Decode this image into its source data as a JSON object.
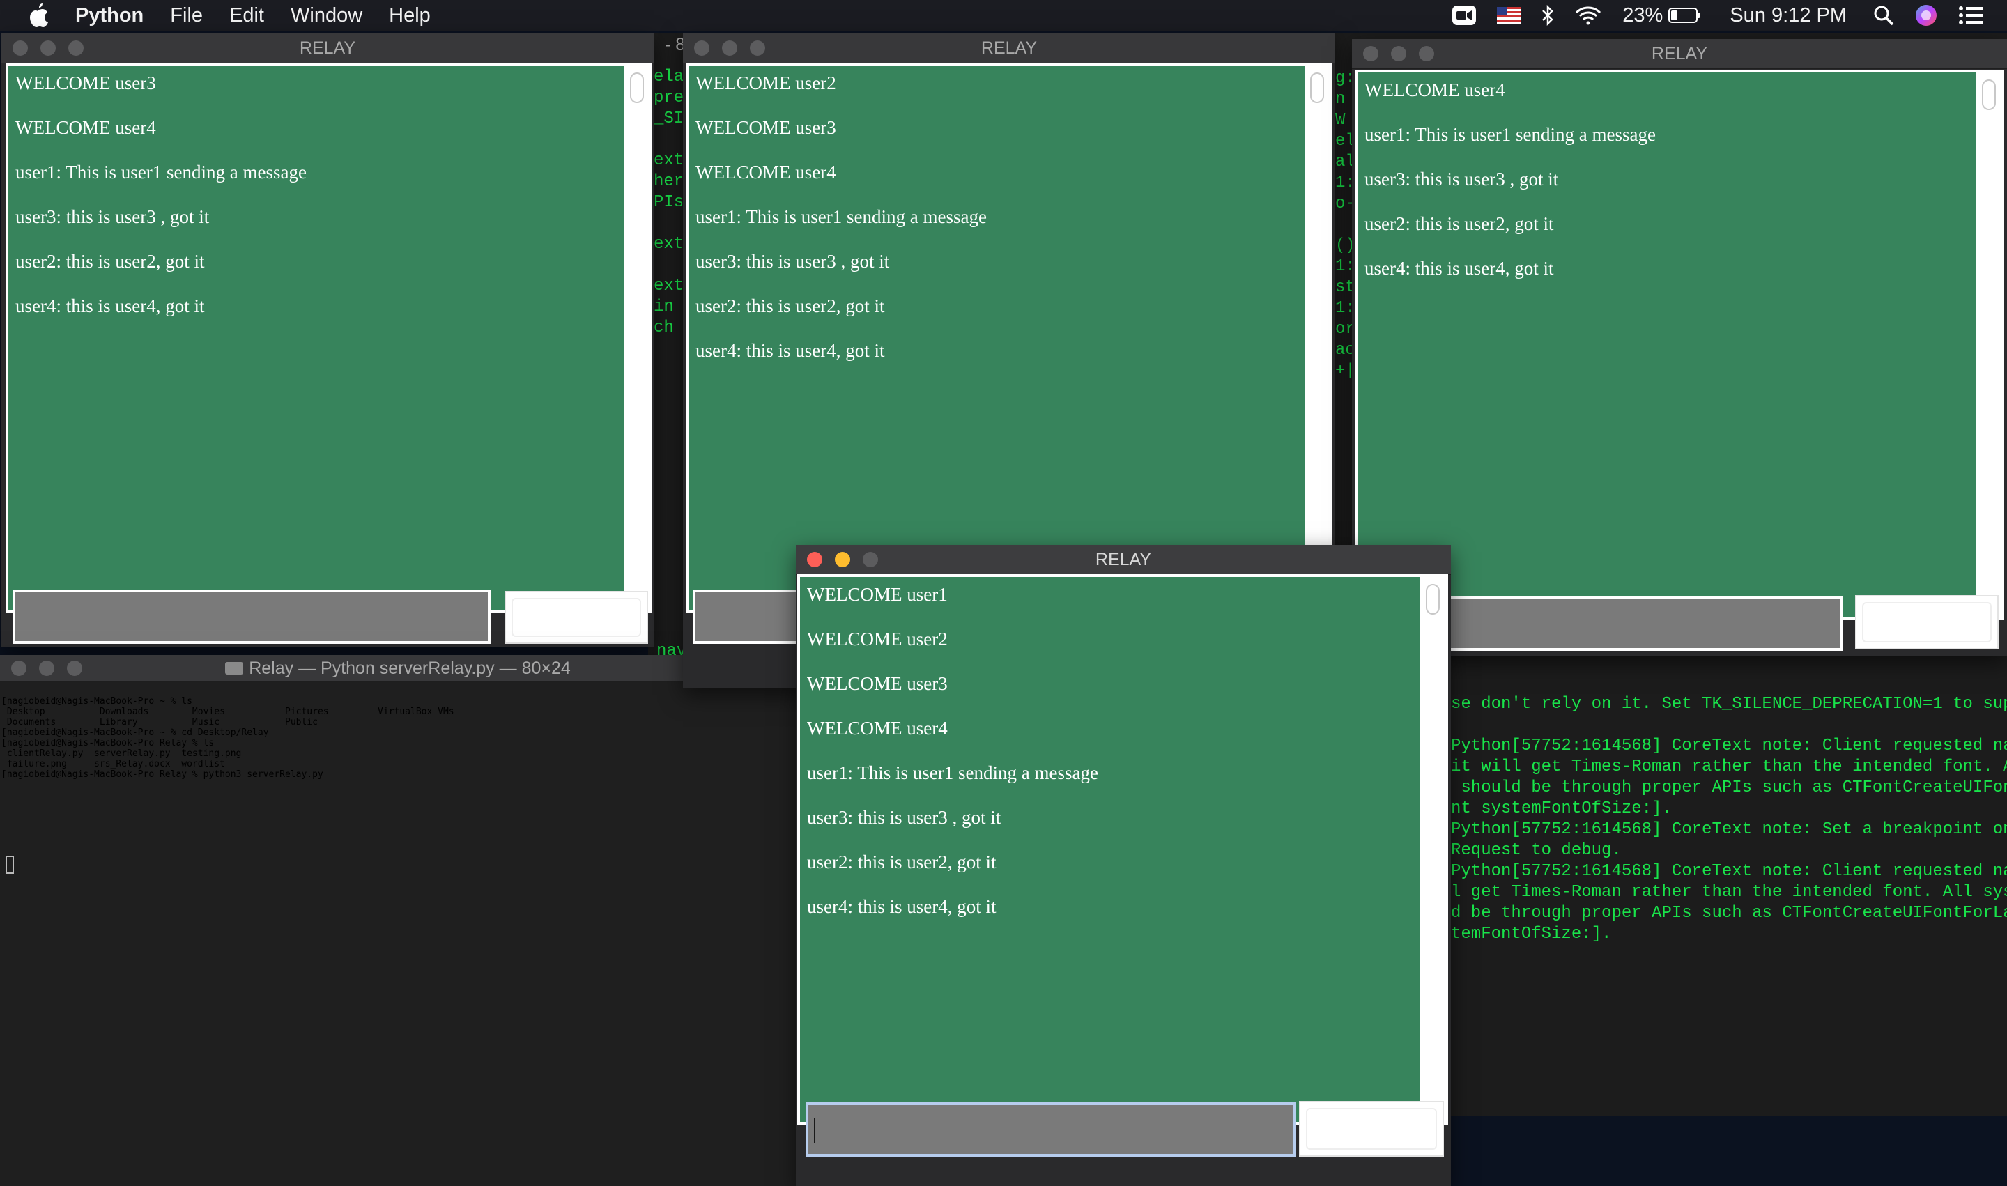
{
  "menubar": {
    "app_name": "Python",
    "menus": [
      "File",
      "Edit",
      "Window",
      "Help"
    ],
    "battery": "23%",
    "clock": "Sun 9:12 PM",
    "icons": [
      "apple-icon",
      "zoom-icon",
      "us-flag-icon",
      "bluetooth-icon",
      "wifi-icon",
      "battery-icon",
      "search-icon",
      "siri-icon",
      "control-center-icon"
    ]
  },
  "windows": {
    "relay_title": "RELAY",
    "user3": {
      "messages": [
        "WELCOME user3",
        "WELCOME user4",
        "user1: This is user1 sending a message",
        "user3: this is user3 , got it",
        "user2: this is user2, got it",
        "user4: this is user4, got it"
      ]
    },
    "user2": {
      "messages": [
        "WELCOME user2",
        "WELCOME user3",
        "WELCOME user4",
        "user1: This is user1 sending a message",
        "user3: this is user3 , got it",
        "user2: this is user2, got it",
        "user4: this is user4, got it"
      ]
    },
    "user4": {
      "messages": [
        "WELCOME user4",
        "user1: This is user1 sending a message",
        "user3: this is user3 , got it",
        "user2: this is user2, got it",
        "user4: this is user4, got it"
      ]
    },
    "user1": {
      "messages": [
        "WELCOME user1",
        "WELCOME user2",
        "WELCOME user3",
        "WELCOME user4",
        "user1: This is user1 sending a message",
        "user3: this is user3 , got it",
        "user2: this is user2, got it",
        "user4: this is user4, got it"
      ]
    }
  },
  "terminal": {
    "title": "Relay — Python serverRelay.py — 80×24",
    "lines": [
      "[nagiobeid@Nagis-MacBook-Pro ~ % ls",
      " Desktop          Downloads        Movies           Pictures         VirtualBox VMs",
      " Documents        Library          Music            Public",
      "[nagiobeid@Nagis-MacBook-Pro ~ % cd Desktop/Relay",
      "[nagiobeid@Nagis-MacBook-Pro Relay % ls",
      " clientRelay.py  serverRelay.py  testing.png",
      " failure.png     srs_Relay.docx  wordlist",
      "[nagiobeid@Nagis-MacBook-Pro Relay % python3 serverRelay.py"
    ]
  },
  "bg_terminal": {
    "title_fragment": "- 8(",
    "left_fragments": [
      "ela",
      "pre",
      "_SI",
      "",
      "ext",
      "her",
      "PIs",
      "",
      "ext",
      "",
      "ext",
      "in",
      "ch"
    ],
    "mid_fragments": [
      "g:",
      "n",
      "W",
      "el",
      "al",
      "1:",
      "o-",
      "",
      "()",
      "1:",
      "st",
      "1:",
      "or",
      "ac",
      "+|"
    ],
    "right_lines": [
      "se don't rely on it. Set TK_SILENCE_DEPRECATION=1 to sup",
      "",
      "Python[57752:1614568] CoreText note: Client requested na",
      "it will get Times-Roman rather than the intended font. A",
      " should be through proper APIs such as CTFontCreateUIFon",
      "nt systemFontOfSize:].",
      "Python[57752:1614568] CoreText note: Set a breakpoint on",
      "Request to debug.",
      "Python[57752:1614568] CoreText note: Client requested na",
      "l get Times-Roman rather than the intended font. All sys",
      "d be through proper APIs such as CTFontCreateUIFontForLa",
      "temFontOfSize:]."
    ],
    "bottom_fragment": "nav"
  }
}
